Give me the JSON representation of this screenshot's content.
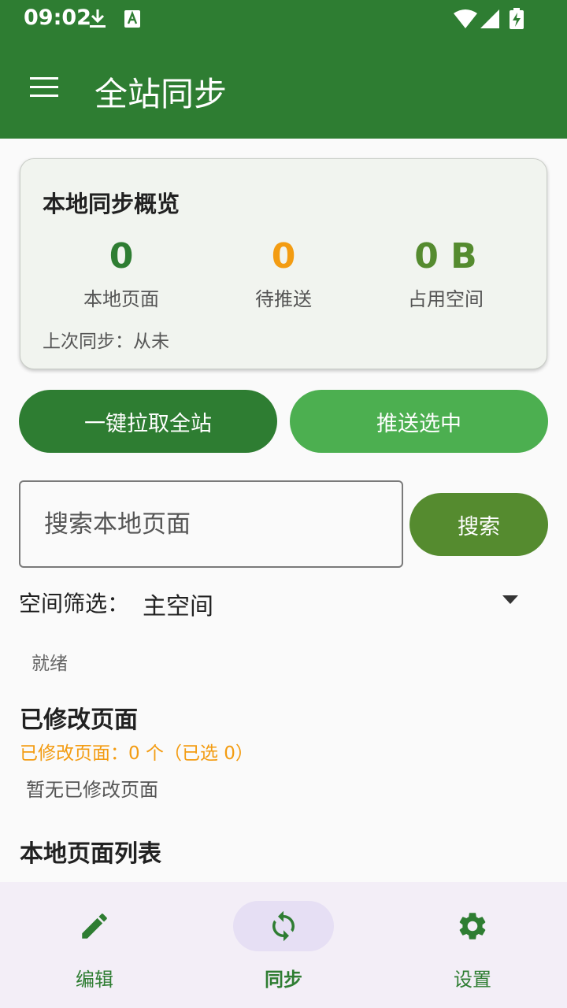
{
  "status_bar": {
    "time": "09:02",
    "icons": [
      "download-icon",
      "font-icon",
      "wifi-icon",
      "signal-icon",
      "battery-charging-icon"
    ]
  },
  "app_bar": {
    "menu_icon": "hamburger-menu-icon",
    "title": "全站同步"
  },
  "overview": {
    "title": "本地同步概览",
    "stats": [
      {
        "value": "0",
        "label": "本地页面",
        "color": "#2e7d32"
      },
      {
        "value": "0",
        "label": "待推送",
        "color": "#f39c12"
      },
      {
        "value": "0 B",
        "label": "占用空间",
        "color": "#558b2f"
      }
    ],
    "last_sync": "上次同步：从未"
  },
  "actions": {
    "pull_all": "一键拉取全站",
    "push_selected": "推送选中"
  },
  "search": {
    "placeholder": "搜索本地页面",
    "value": "",
    "button": "搜索"
  },
  "filter": {
    "label": "空间筛选：",
    "selected": "主空间"
  },
  "status": "就绪",
  "modified": {
    "title": "已修改页面",
    "count_text": "已修改页面：0 个（已选 0）",
    "empty": "暂无已修改页面"
  },
  "local_list": {
    "title": "本地页面列表"
  },
  "bottom_nav": {
    "items": [
      {
        "label": "编辑",
        "icon": "pencil-icon",
        "active": false
      },
      {
        "label": "同步",
        "icon": "sync-icon",
        "active": true
      },
      {
        "label": "设置",
        "icon": "gear-icon",
        "active": false
      }
    ]
  },
  "colors": {
    "primary": "#2e7d32",
    "secondary": "#4caf50",
    "search_button": "#558b2f",
    "pending": "#f39c12",
    "nav_active_pill": "#e6dff4",
    "nav_background": "#f3eef7"
  }
}
